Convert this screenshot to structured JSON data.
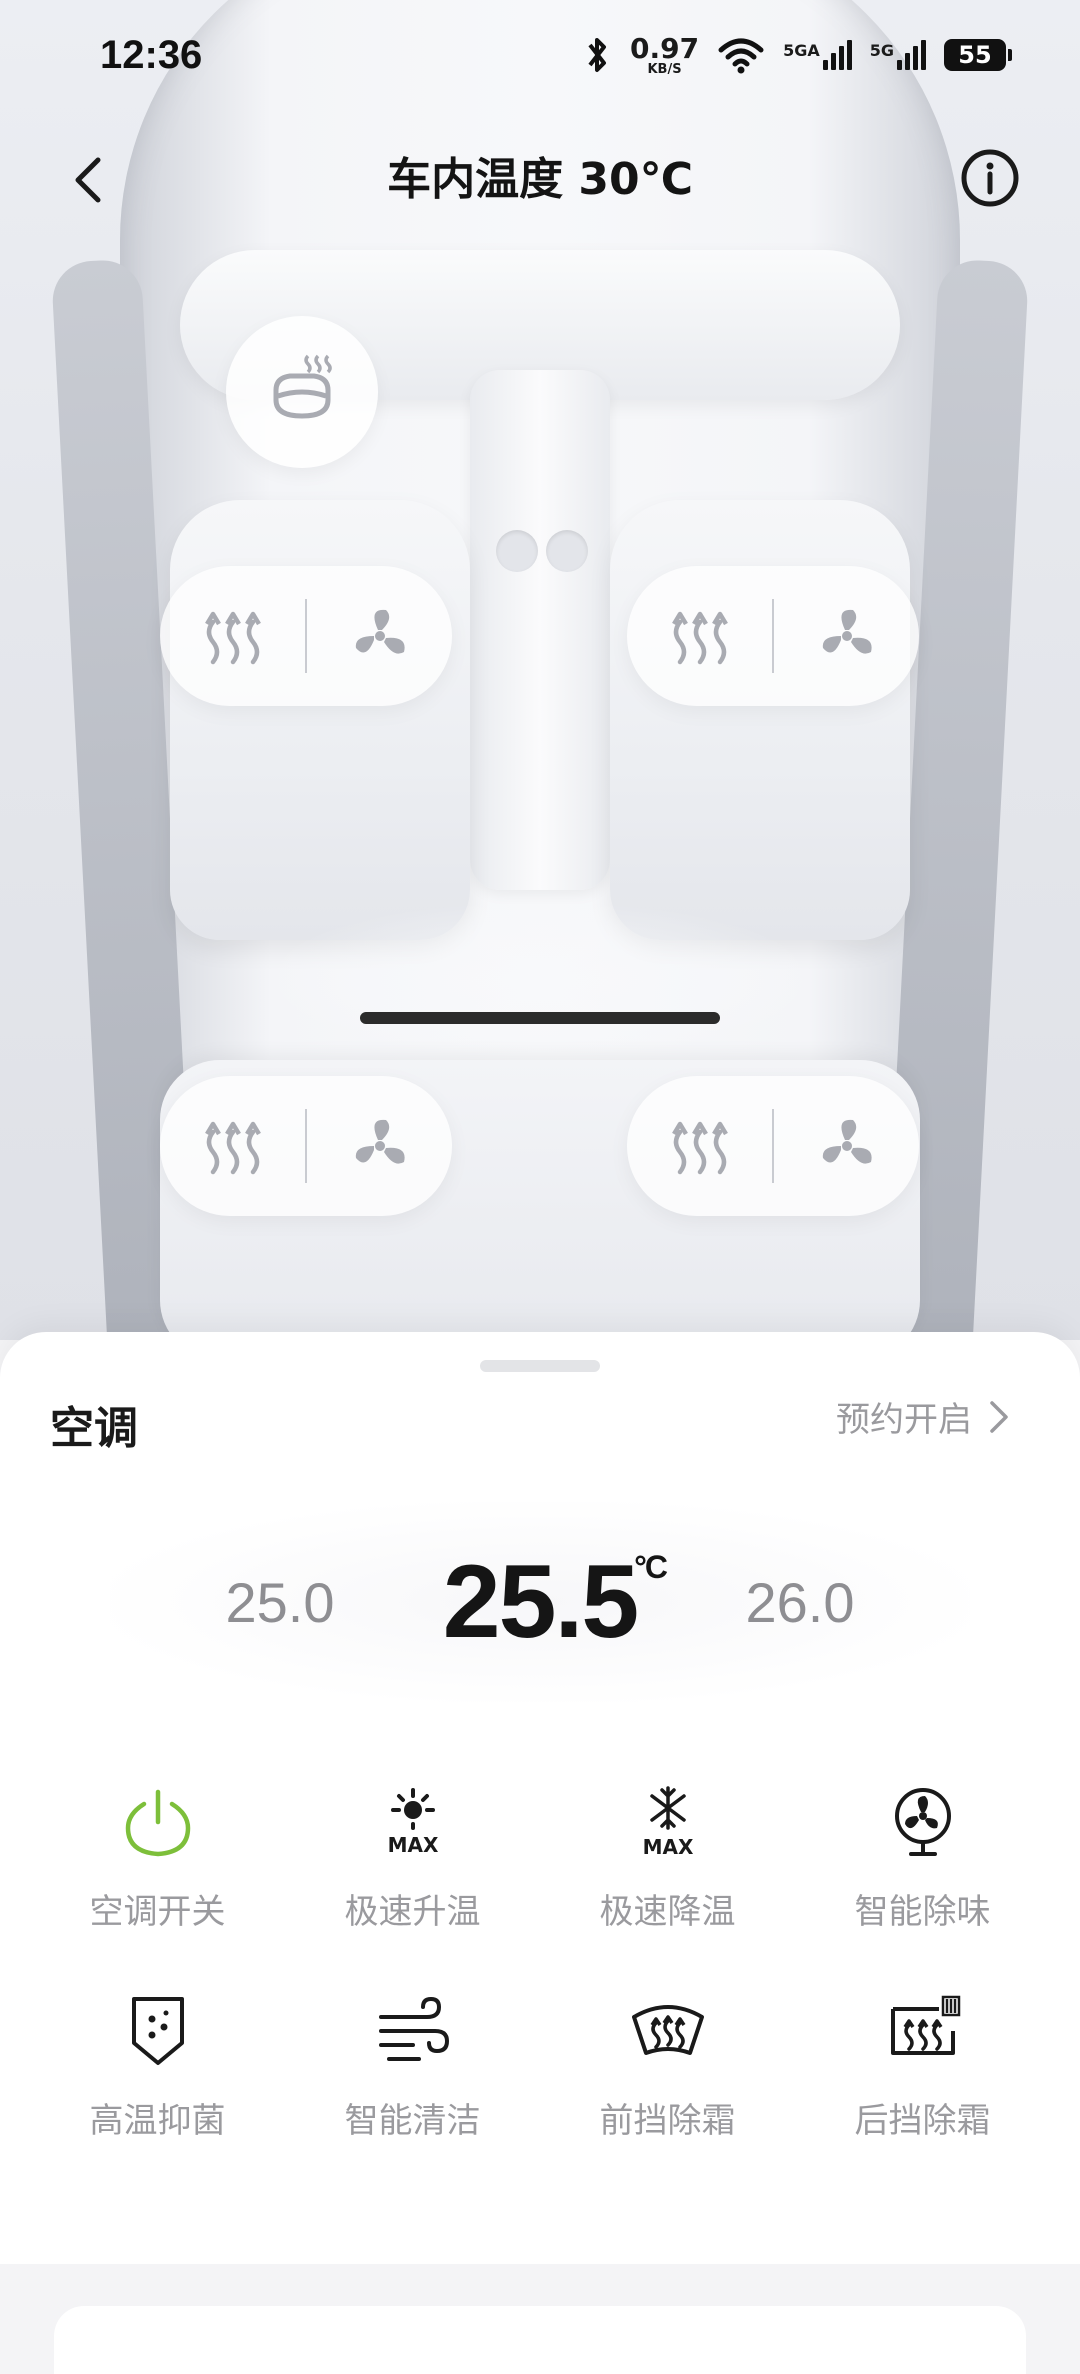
{
  "status_bar": {
    "time": "12:36",
    "net_speed": "0.97",
    "net_speed_unit": "KB/S",
    "signal1_label": "5GA",
    "signal2_label": "5G",
    "battery": "55"
  },
  "header": {
    "title": "车内温度 30℃"
  },
  "ac": {
    "section_title": "空调",
    "schedule_label": "预约开启",
    "temp_lower": "25.0",
    "temp_current": "25.5",
    "temp_unit": "°C",
    "temp_higher": "26.0"
  },
  "functions": [
    {
      "label": "空调开关",
      "icon": "power-icon",
      "active": true
    },
    {
      "label": "极速升温",
      "icon": "max-heat-icon"
    },
    {
      "label": "极速降温",
      "icon": "max-cool-icon"
    },
    {
      "label": "智能除味",
      "icon": "fan-icon"
    },
    {
      "label": "高温抑菌",
      "icon": "sterilize-icon"
    },
    {
      "label": "智能清洁",
      "icon": "wind-clean-icon"
    },
    {
      "label": "前挡除霜",
      "icon": "front-defrost-icon"
    },
    {
      "label": "后挡除霜",
      "icon": "rear-defrost-icon"
    }
  ],
  "colors": {
    "active_green": "#7dbf3a",
    "label_gray": "#9a9a9e"
  }
}
